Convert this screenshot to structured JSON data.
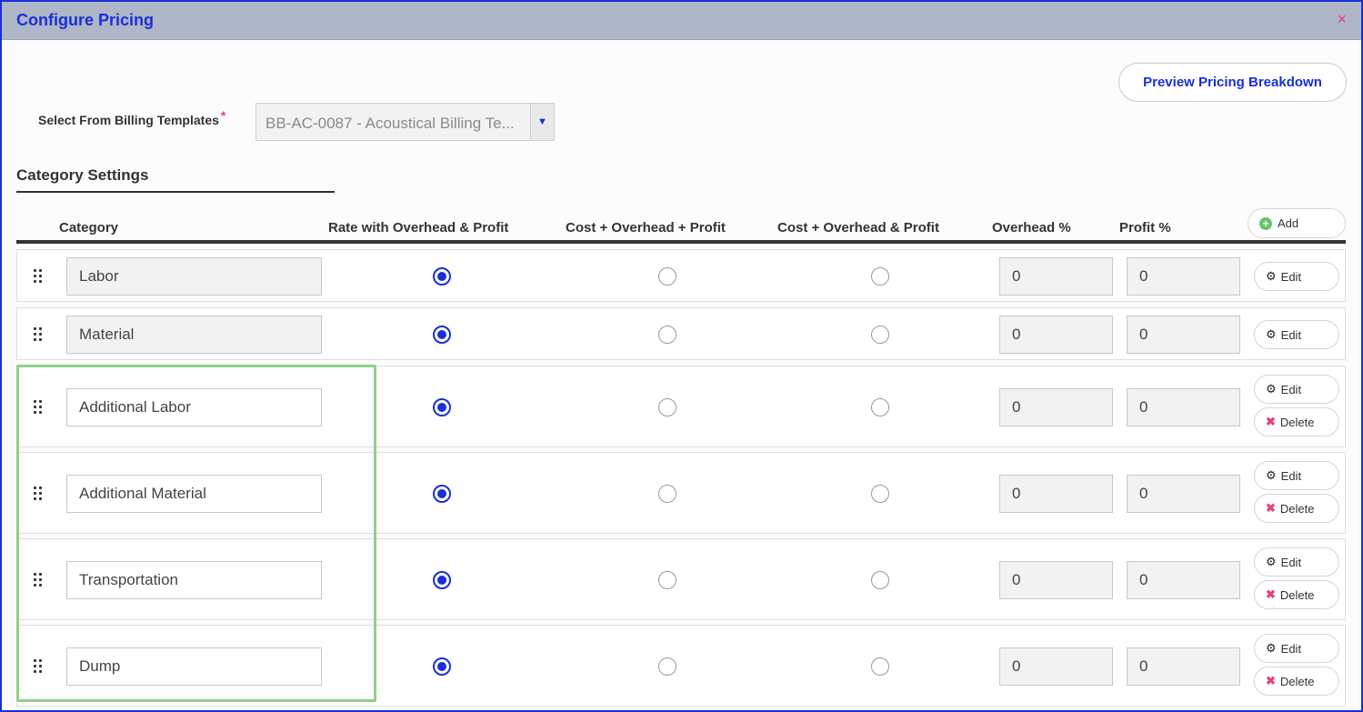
{
  "dialog": {
    "title": "Configure Pricing",
    "close_glyph": "×"
  },
  "preview_button": "Preview Pricing Breakdown",
  "template": {
    "label": "Select From Billing Templates",
    "required_mark": "*",
    "value": "BB-AC-0087 - Acoustical Billing Te...",
    "arrow": "▼"
  },
  "section_title": "Category Settings",
  "columns": {
    "category": "Category",
    "rate": "Rate with Overhead & Profit",
    "cost_plus": "Cost + Overhead + Profit",
    "cost_and": "Cost + Overhead & Profit",
    "overhead": "Overhead %",
    "profit": "Profit %"
  },
  "add_button": {
    "label": "Add",
    "icon": "plus-circle-icon"
  },
  "actions": {
    "edit": "Edit",
    "delete": "Delete"
  },
  "icons": {
    "edit": "gear-icon",
    "delete": "x-icon",
    "drag": "drag-handle-icon"
  },
  "colors": {
    "accent": "#1a2fd6",
    "title_bar": "#aeb6c8",
    "delete": "#e0457a",
    "add": "#6cc26b",
    "highlight": "#8fd08a"
  },
  "rows": [
    {
      "category": "Labor",
      "editable": false,
      "selected_pricing": "rate",
      "overhead": "0",
      "profit": "0",
      "can_delete": false
    },
    {
      "category": "Material",
      "editable": false,
      "selected_pricing": "rate",
      "overhead": "0",
      "profit": "0",
      "can_delete": false
    },
    {
      "category": "Additional Labor",
      "editable": true,
      "selected_pricing": "rate",
      "overhead": "0",
      "profit": "0",
      "can_delete": true
    },
    {
      "category": "Additional Material",
      "editable": true,
      "selected_pricing": "rate",
      "overhead": "0",
      "profit": "0",
      "can_delete": true
    },
    {
      "category": "Transportation",
      "editable": true,
      "selected_pricing": "rate",
      "overhead": "0",
      "profit": "0",
      "can_delete": true
    },
    {
      "category": "Dump",
      "editable": true,
      "selected_pricing": "rate",
      "overhead": "0",
      "profit": "0",
      "can_delete": true
    }
  ]
}
